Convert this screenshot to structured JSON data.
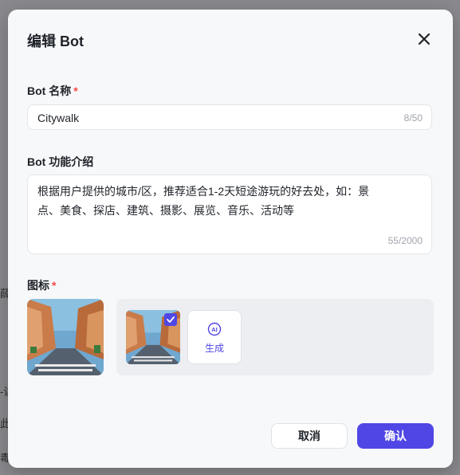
{
  "background": {
    "hints": [
      "薛",
      "-读",
      "此",
      "毒"
    ]
  },
  "dialog": {
    "title": "编辑 Bot",
    "name_field": {
      "label": "Bot 名称",
      "required": "*",
      "value": "Citywalk",
      "counter": "8/50"
    },
    "desc_field": {
      "label": "Bot 功能介绍",
      "value": "根据用户提供的城市/区，推荐适合1-2天短途游玩的好去处，如：景点、美食、探店、建筑、摄影、展览、音乐、活动等",
      "counter": "55/2000"
    },
    "icon_field": {
      "label": "图标",
      "required": "*",
      "generate_label": "生成",
      "ai_badge": "AI"
    },
    "buttons": {
      "cancel": "取消",
      "confirm": "确认"
    }
  },
  "colors": {
    "accent": "#5046e5",
    "required": "#f54a45"
  }
}
